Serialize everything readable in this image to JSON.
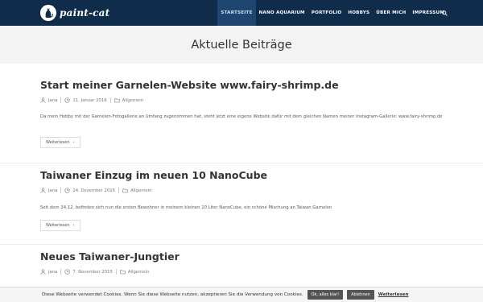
{
  "site": {
    "logo_text": "paint-cat"
  },
  "nav": {
    "items": [
      "STARTSEITE",
      "NANO AQUARIUM",
      "PORTFOLIO",
      "HOBBYS",
      "ÜBER MICH",
      "IMPRESSUM"
    ],
    "search_icon": "search-icon"
  },
  "page": {
    "title": "Aktuelle Beiträge"
  },
  "posts": [
    {
      "title": "Start meiner Garnelen-Website www.fairy-shrimp.de",
      "author": "Jana",
      "date": "11. Januar 2016",
      "category": "Allgemein",
      "excerpt": "Da mein Hobby mit der Garnelen-Fotogallerie an Umfang zugenommen hat, steht jetzt eine eigene Website dafür mit dem gleichen Namen meiner Instagram-Gallerie: www.fairy-shrimp.de",
      "more_label": "Weiterlesen"
    },
    {
      "title": "Taiwaner Einzug im neuen 10 NanoCube",
      "author": "Jana",
      "date": "24. Dezember 2015",
      "category": "Allgemein",
      "excerpt": "Seit dem 24.12. befinden sich nun die ersten Bewohner in meinem kleinen 10 Liter NanoCube, ein schöne Mischung an Taiwan Garnelen",
      "more_label": "Weiterlesen"
    },
    {
      "title": "Neues Taiwaner-Jungtier",
      "author": "Jana",
      "date": "7. November 2015",
      "category": "Allgemein"
    }
  ],
  "cookie": {
    "text": "Diese Webseite verwendet Cookies. Wenn Sie diese Webseite nutzen, akzeptieren Sie die Verwendung von Cookies.",
    "accept_label": "Ok, alles klar!",
    "decline_label": "Ablehnen",
    "more_label": "Weiterlesen"
  },
  "colors": {
    "header_bg": "#0f2c4b",
    "nav_active_bg": "#1e4670",
    "page_header_bg": "#f3f3f3"
  }
}
